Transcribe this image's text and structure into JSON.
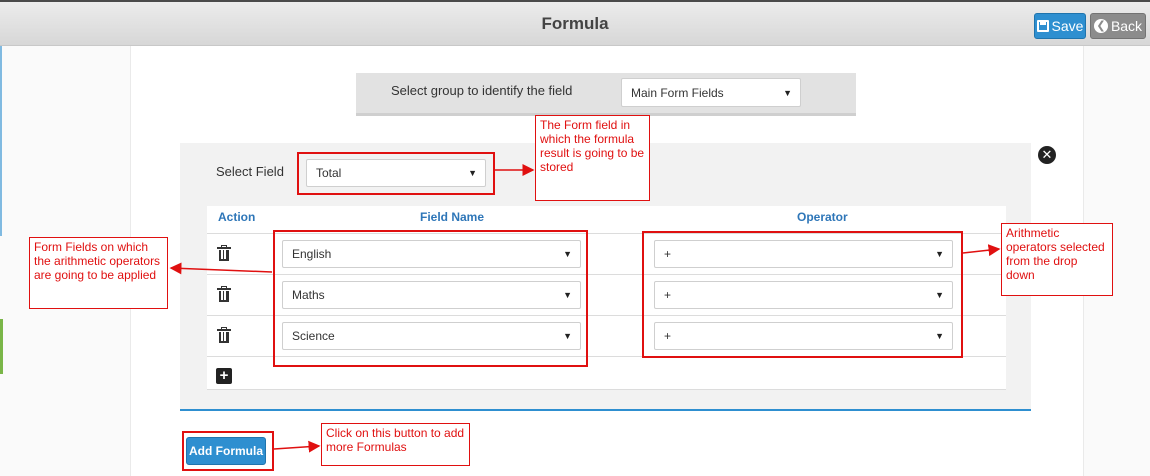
{
  "header": {
    "title": "Formula",
    "save_label": "Save",
    "back_label": "Back"
  },
  "group": {
    "label": "Select group to identify the field",
    "selected": "Main Form Fields"
  },
  "select_field": {
    "label": "Select Field",
    "selected": "Total"
  },
  "table": {
    "columns": [
      "Action",
      "Field Name",
      "Operator"
    ],
    "rows": [
      {
        "field": "English",
        "operator": "+"
      },
      {
        "field": "Maths",
        "operator": "+"
      },
      {
        "field": "Science",
        "operator": "+"
      }
    ]
  },
  "add_formula_label": "Add Formula",
  "annotations": {
    "result_field": "The Form field in which the formula result is going to be stored",
    "form_fields": "Form Fields on which the arithmetic operators are going to be applied",
    "operators": "Arithmetic operators selected from the drop down",
    "add_button": "Click on this button to add more Formulas"
  },
  "icons": {
    "save": "save-icon",
    "back": "back-circle-icon",
    "close": "close-circle-icon",
    "delete": "trash-icon",
    "add_row": "plus-square-icon",
    "dropdown": "caret-down-icon"
  },
  "colors": {
    "accent": "#2e8fd0",
    "annotation": "#e01010"
  }
}
